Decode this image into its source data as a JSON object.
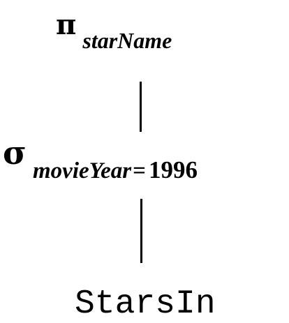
{
  "diagram": {
    "projection": {
      "operator": "π",
      "attribute": "starName"
    },
    "selection": {
      "operator": "σ",
      "attribute": "movieYear",
      "comparator": "=",
      "value": "1996"
    },
    "relation": {
      "name": "StarsIn"
    },
    "colors": {
      "ink": "#000000",
      "background": "#ffffff"
    }
  }
}
